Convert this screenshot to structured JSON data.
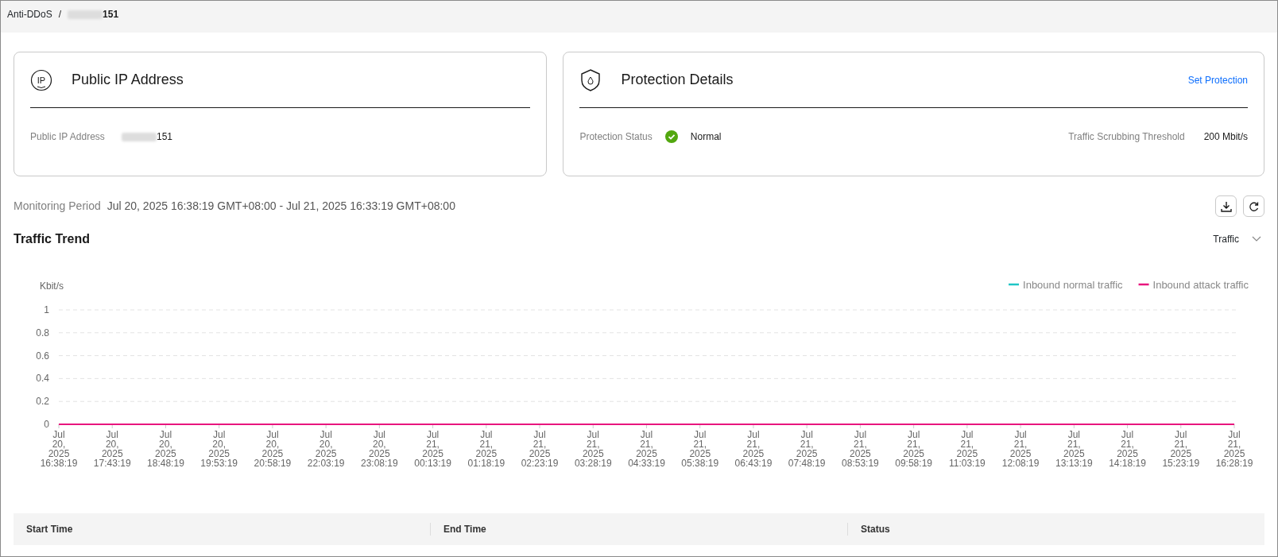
{
  "breadcrumb": {
    "root": "Anti-DDoS",
    "separator": "/",
    "current_suffix": "151"
  },
  "ip_card": {
    "icon_text": "IP",
    "title": "Public IP Address",
    "field_label": "Public IP Address",
    "field_value_suffix": "151"
  },
  "protection_card": {
    "title": "Protection Details",
    "action_link": "Set Protection",
    "status_label": "Protection Status",
    "status_value": "Normal",
    "threshold_label": "Traffic Scrubbing Threshold",
    "threshold_value": "200 Mbit/s"
  },
  "monitoring": {
    "label": "Monitoring Period",
    "period": "Jul 20, 2025 16:38:19 GMT+08:00 - Jul 21, 2025 16:33:19 GMT+08:00"
  },
  "traffic_trend": {
    "title": "Traffic Trend",
    "metric_select": "Traffic",
    "chart_data": {
      "type": "line",
      "grid": true,
      "ylabel": "Kbit/s",
      "ylim": [
        0,
        1
      ],
      "yticks": [
        0,
        0.2,
        0.4,
        0.6,
        0.8,
        1
      ],
      "categories": [
        "Jul 20, 2025 16:38:19",
        "Jul 20, 2025 17:43:19",
        "Jul 20, 2025 18:48:19",
        "Jul 20, 2025 19:53:19",
        "Jul 20, 2025 20:58:19",
        "Jul 20, 2025 22:03:19",
        "Jul 20, 2025 23:08:19",
        "Jul 21, 2025 00:13:19",
        "Jul 21, 2025 01:18:19",
        "Jul 21, 2025 02:23:19",
        "Jul 21, 2025 03:28:19",
        "Jul 21, 2025 04:33:19",
        "Jul 21, 2025 05:38:19",
        "Jul 21, 2025 06:43:19",
        "Jul 21, 2025 07:48:19",
        "Jul 21, 2025 08:53:19",
        "Jul 21, 2025 09:58:19",
        "Jul 21, 2025 11:03:19",
        "Jul 21, 2025 12:08:19",
        "Jul 21, 2025 13:13:19",
        "Jul 21, 2025 14:18:19",
        "Jul 21, 2025 15:23:19",
        "Jul 21, 2025 16:28:19"
      ],
      "series": [
        {
          "name": "Inbound normal traffic",
          "color": "#1fc5c5",
          "values": [
            null,
            null,
            null,
            null,
            null,
            null,
            null,
            null,
            null,
            null,
            null,
            null,
            null,
            null,
            null,
            null,
            null,
            null,
            null,
            null,
            null,
            null,
            null
          ]
        },
        {
          "name": "Inbound attack traffic",
          "color": "#e8157e",
          "values": [
            0,
            0,
            0,
            0,
            0,
            0,
            0,
            0,
            0,
            0,
            0,
            0,
            0,
            0,
            0,
            0,
            0,
            0,
            0,
            0,
            0,
            0,
            0
          ]
        }
      ]
    }
  },
  "attack_table": {
    "columns": [
      "Start Time",
      "End Time",
      "Status"
    ]
  }
}
